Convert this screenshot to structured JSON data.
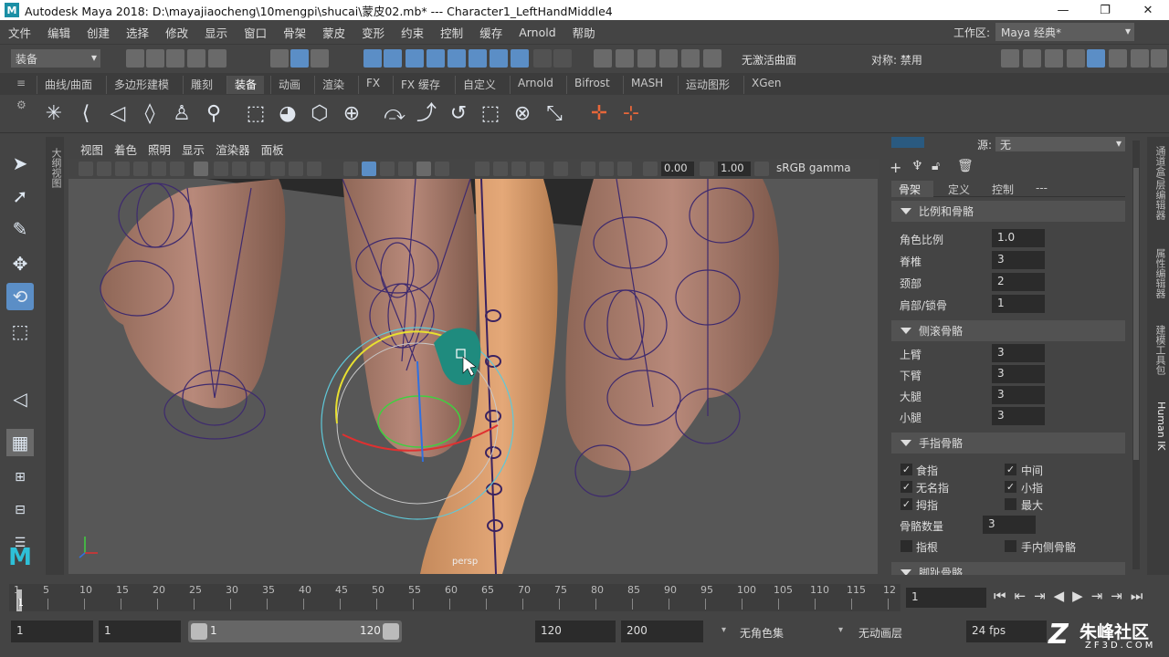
{
  "window": {
    "title": "Autodesk Maya 2018: D:\\mayajiaocheng\\10mengpi\\shucai\\蒙皮02.mb*   ---   Character1_LeftHandMiddle4",
    "min": "—",
    "max": "❐",
    "close": "✕"
  },
  "menubar": [
    "文件",
    "编辑",
    "创建",
    "选择",
    "修改",
    "显示",
    "窗口",
    "骨架",
    "蒙皮",
    "变形",
    "约束",
    "控制",
    "缓存",
    "Arnold",
    "帮助"
  ],
  "workspace": {
    "label": "工作区:",
    "value": "Maya 经典*"
  },
  "statusline": {
    "mode": "装备",
    "curve_label": "无激活曲面",
    "symmetry": "对称: 禁用"
  },
  "shelf_tabs": [
    "曲线/曲面",
    "多边形建模",
    "雕刻",
    "装备",
    "动画",
    "渲染",
    "FX",
    "FX 缓存",
    "自定义",
    "Arnold",
    "Bifrost",
    "MASH",
    "运动图形",
    "XGen"
  ],
  "shelf_active": 3,
  "outliner_tab": "大纲视图",
  "viewport": {
    "menu": [
      "视图",
      "着色",
      "照明",
      "显示",
      "渲染器",
      "面板"
    ],
    "exposure": "0.00",
    "gamma_value": "1.00",
    "colorspace": "sRGB gamma",
    "camera": "persp"
  },
  "right_panel": {
    "source_label": "源:",
    "source_value": "无",
    "tabs": [
      "骨架",
      "定义",
      "控制",
      "---"
    ],
    "sections": {
      "scale": {
        "title": "比例和骨骼",
        "rows": [
          {
            "label": "角色比例",
            "value": "1.0"
          },
          {
            "label": "脊椎",
            "value": "3"
          },
          {
            "label": "颈部",
            "value": "2"
          },
          {
            "label": "肩部/锁骨",
            "value": "1"
          }
        ]
      },
      "roll": {
        "title": "侧滚骨骼",
        "rows": [
          {
            "label": "上臂",
            "value": "3"
          },
          {
            "label": "下臂",
            "value": "3"
          },
          {
            "label": "大腿",
            "value": "3"
          },
          {
            "label": "小腿",
            "value": "3"
          }
        ]
      },
      "fingers": {
        "title": "手指骨骼",
        "checks": [
          {
            "label": "食指",
            "checked": true
          },
          {
            "label": "中间",
            "checked": true
          },
          {
            "label": "无名指",
            "checked": true
          },
          {
            "label": "小指",
            "checked": true
          },
          {
            "label": "拇指",
            "checked": true
          },
          {
            "label": "最大",
            "checked": false
          }
        ],
        "count_label": "骨骼数量",
        "count_value": "3",
        "extra": [
          {
            "label": "指根",
            "checked": false
          },
          {
            "label": "手内侧骨骼",
            "checked": false
          }
        ]
      },
      "toes": {
        "title": "脚趾骨骼"
      }
    }
  },
  "vertical_tabs": [
    "通道盒/层编辑器",
    "属性编辑器",
    "建模工具包",
    "Human IK"
  ],
  "timeline": {
    "ticks": [
      "1",
      "5",
      "10",
      "15",
      "20",
      "25",
      "30",
      "35",
      "40",
      "45",
      "50",
      "55",
      "60",
      "65",
      "70",
      "75",
      "80",
      "85",
      "90",
      "95",
      "100",
      "105",
      "110",
      "115",
      "12"
    ],
    "current_frame": "1",
    "playhead": "1"
  },
  "range": {
    "start": "1",
    "playback_start": "1",
    "slider_start": "1",
    "slider_end": "120",
    "playback_end": "120",
    "end": "200",
    "charset": "无角色集",
    "anim_layer": "无动画层",
    "fps": "24 fps"
  },
  "watermark": {
    "main": "朱峰社区",
    "sub": "ZF3D.COM"
  }
}
